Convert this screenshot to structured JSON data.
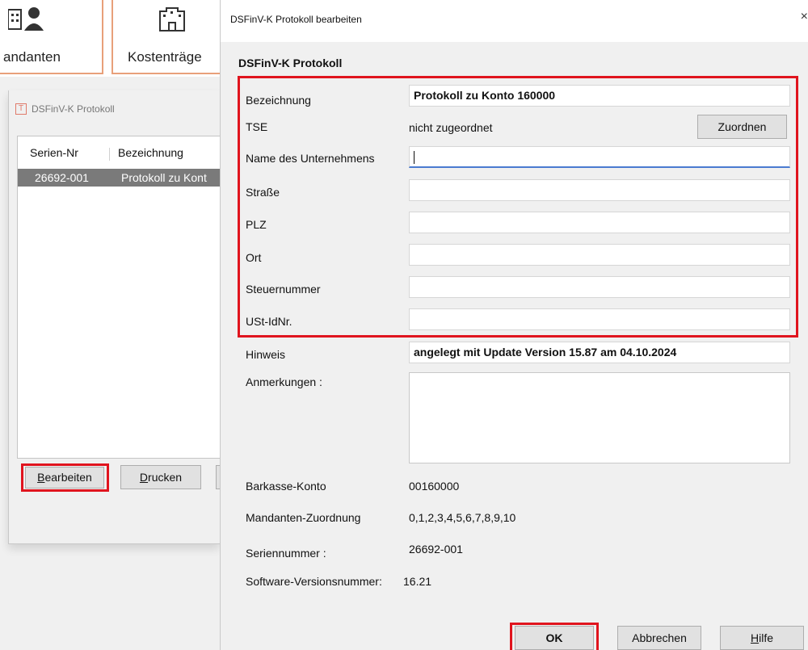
{
  "background_app": {
    "ribbon": {
      "mandanten_label": "andanten",
      "kostentraeger_label": "Kostenträge"
    },
    "list_window": {
      "title": "DSFinV-K Protokoll",
      "columns": [
        "Serien-Nr",
        "Bezeichnung"
      ],
      "rows": [
        {
          "serial": "26692-001",
          "name": "Protokoll zu Kont"
        }
      ],
      "buttons": {
        "edit_label_accel": "B",
        "edit_label_rest": "earbeiten",
        "print_label_accel": "D",
        "print_label_rest": "rucken"
      }
    }
  },
  "dialog": {
    "title": "DSFinV-K Protokoll bearbeiten",
    "close_glyph": "×",
    "section_title": "DSFinV-K Protokoll",
    "fields": {
      "bezeichnung": {
        "label": "Bezeichnung",
        "value": "Protokoll zu Konto 160000"
      },
      "tse": {
        "label": "TSE",
        "value": "nicht zugeordnet",
        "button": "Zuordnen"
      },
      "unternehmen": {
        "label": "Name des Unternehmens",
        "value": ""
      },
      "strasse": {
        "label": "Straße",
        "value": ""
      },
      "plz": {
        "label": "PLZ",
        "value": ""
      },
      "ort": {
        "label": "Ort",
        "value": ""
      },
      "steuernummer": {
        "label": "Steuernummer",
        "value": ""
      },
      "ustid": {
        "label": "USt-IdNr.",
        "value": ""
      },
      "hinweis": {
        "label": "Hinweis",
        "value": "angelegt mit Update Version 15.87 am 04.10.2024"
      },
      "anmerkungen": {
        "label": "Anmerkungen :",
        "value": ""
      }
    },
    "info": {
      "barkasse": {
        "label": "Barkasse-Konto",
        "value": "00160000"
      },
      "mandanten": {
        "label": "Mandanten-Zuordnung",
        "value": "0,1,2,3,4,5,6,7,8,9,10"
      },
      "seriennummer": {
        "label": "Seriennummer :",
        "value": "26692-001"
      },
      "software": {
        "label": "Software-Versionsnummer:",
        "value": "16.21"
      }
    },
    "buttons": {
      "ok": "OK",
      "cancel": "Abbrechen",
      "help_accel": "H",
      "help_rest": "ilfe"
    }
  },
  "colors": {
    "highlight_frame": "#e0141e",
    "ribbon_border": "#e8a07a",
    "selected_row": "#7a7a7a",
    "focus_underline": "#4a7bd0"
  }
}
